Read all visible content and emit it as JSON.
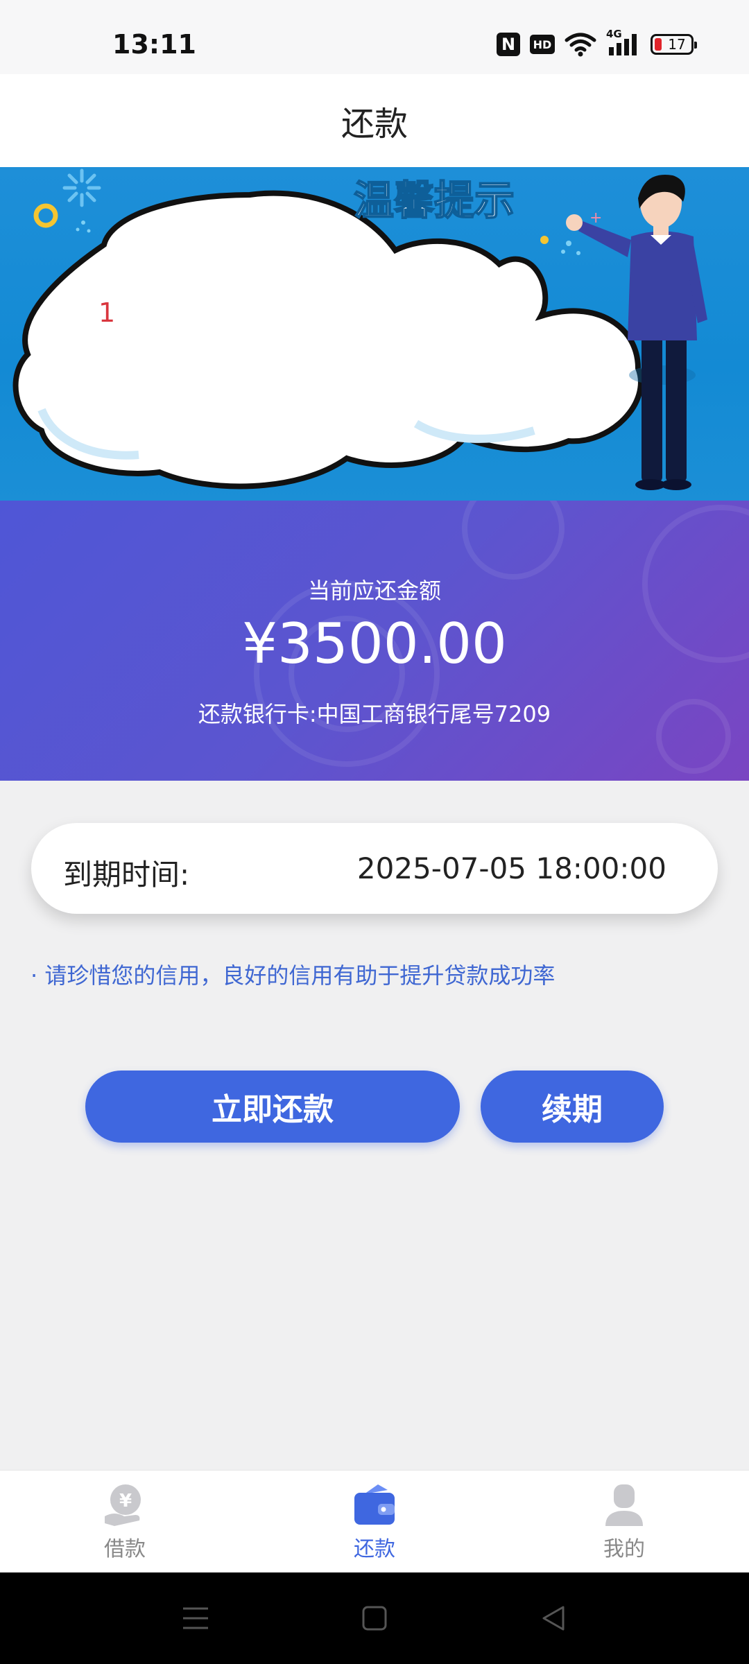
{
  "status_bar": {
    "time": "13:11",
    "nfc": "N",
    "hd": "HD",
    "network": "4G",
    "battery": "17"
  },
  "header": {
    "title": "还款"
  },
  "banner": {
    "heading": "温馨提示",
    "note": "1"
  },
  "amount_card": {
    "label": "当前应还金额",
    "amount": "¥3500.00",
    "bank": "还款银行卡:中国工商银行尾号7209"
  },
  "due": {
    "label": "到期时间:",
    "value": "2025-07-05 18:00:00"
  },
  "tip": "· 请珍惜您的信用，良好的信用有助于提升贷款成功率",
  "buttons": {
    "repay": "立即还款",
    "renew": "续期"
  },
  "tabs": [
    {
      "label": "借款",
      "icon": "loan-yen-icon",
      "active": false
    },
    {
      "label": "还款",
      "icon": "wallet-icon",
      "active": true
    },
    {
      "label": "我的",
      "icon": "profile-icon",
      "active": false
    }
  ],
  "colors": {
    "accent": "#3f67e0",
    "banner_blue": "#1e8fd8",
    "amount_card_from": "#4f56d6",
    "amount_card_to": "#7a45c2"
  }
}
